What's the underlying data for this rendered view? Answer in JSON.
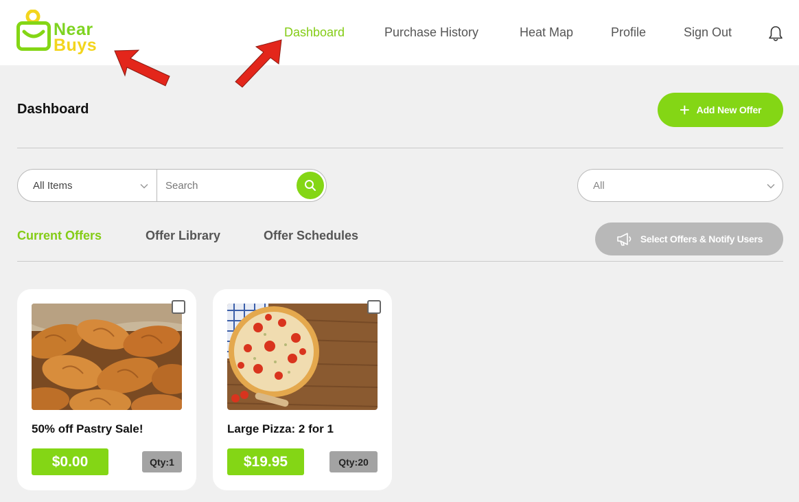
{
  "brand": {
    "line1": "Near",
    "line2": "Buys",
    "primary_color": "#84cc16",
    "secondary_color": "#f3d51e"
  },
  "nav": {
    "items": [
      {
        "label": "Dashboard",
        "active": true
      },
      {
        "label": "Purchase History",
        "active": false
      },
      {
        "label": "Heat Map",
        "active": false
      },
      {
        "label": "Profile",
        "active": false
      },
      {
        "label": "Sign Out",
        "active": false
      }
    ],
    "notifications_icon": "bell-icon"
  },
  "page": {
    "title": "Dashboard",
    "add_button_label": "Add New Offer"
  },
  "filters": {
    "category_value": "All Items",
    "search_placeholder": "Search",
    "status_value": "All"
  },
  "tabs": [
    {
      "label": "Current Offers",
      "active": true
    },
    {
      "label": "Offer Library",
      "active": false
    },
    {
      "label": "Offer Schedules",
      "active": false
    }
  ],
  "notify_button_label": "Select Offers & Notify Users",
  "offers": [
    {
      "title": "50% off Pastry Sale!",
      "price": "$0.00",
      "qty": "Qty:1",
      "image": "croissants-photo",
      "checked": false
    },
    {
      "title": "Large Pizza: 2 for 1",
      "price": "$19.95",
      "qty": "Qty:20",
      "image": "pizza-photo",
      "checked": false
    }
  ],
  "annotation_arrow_color": "#e3261b"
}
